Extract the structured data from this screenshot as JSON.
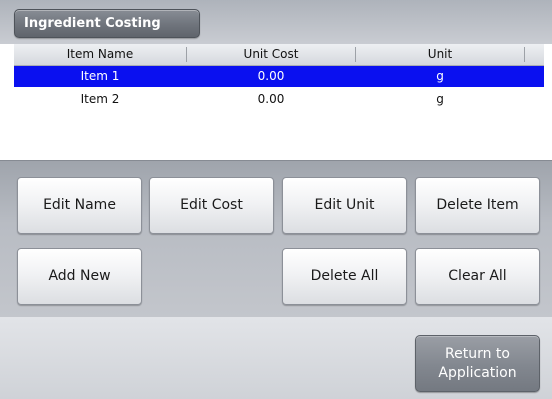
{
  "header": {
    "title": "Ingredient Costing"
  },
  "table": {
    "columns": [
      "Item Name",
      "Unit Cost",
      "Unit"
    ],
    "rows": [
      {
        "name": "Item 1",
        "cost": "0.00",
        "unit": "g",
        "selected": true
      },
      {
        "name": "Item 2",
        "cost": "0.00",
        "unit": "g",
        "selected": false
      }
    ],
    "selection_color": "#0a10f0"
  },
  "actions": {
    "edit_name": "Edit Name",
    "edit_cost": "Edit Cost",
    "edit_unit": "Edit Unit",
    "delete_item": "Delete Item",
    "add_new": "Add New",
    "delete_all": "Delete All",
    "clear_all": "Clear All"
  },
  "footer": {
    "return_line1": "Return to",
    "return_line2": "Application"
  }
}
